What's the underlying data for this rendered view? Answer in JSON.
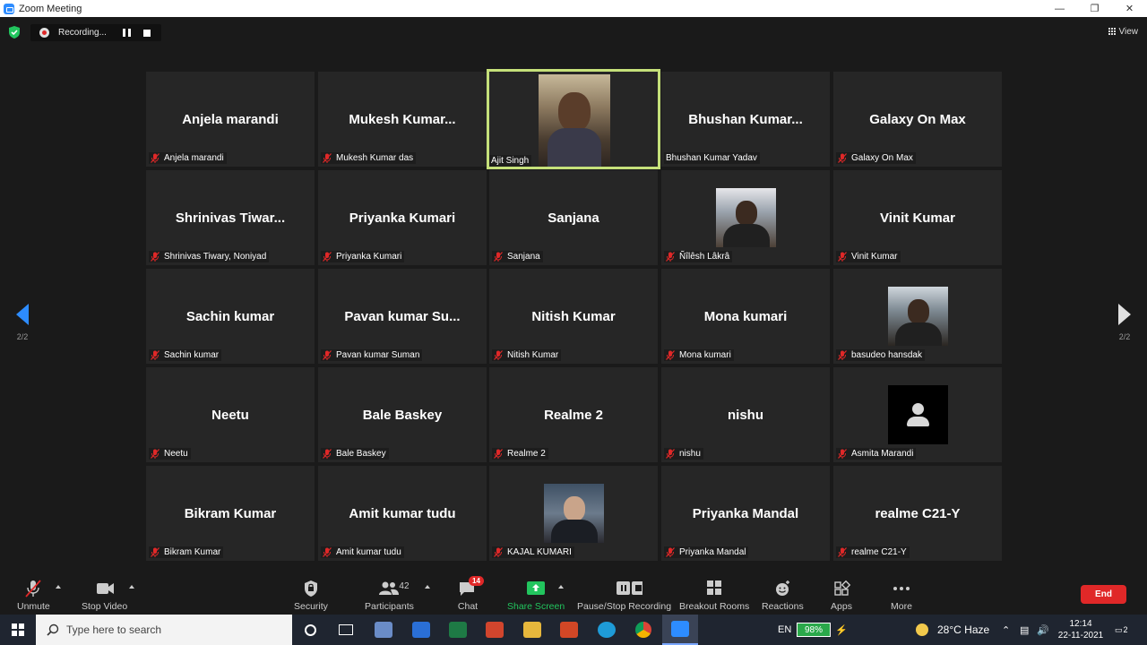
{
  "window": {
    "title": "Zoom Meeting"
  },
  "recording": {
    "status": "Recording..."
  },
  "view_label": "View",
  "pager": {
    "left": "2/2",
    "right": "2/2"
  },
  "participants": [
    {
      "big": "Anjela marandi",
      "label": "Anjela marandi",
      "muted": true
    },
    {
      "big": "Mukesh  Kumar...",
      "label": "Mukesh Kumar das",
      "muted": true
    },
    {
      "big": "",
      "label": "Ajit Singh",
      "muted": false,
      "video": true,
      "active": true
    },
    {
      "big": "Bhushan  Kumar...",
      "label": "Bhushan Kumar Yadav",
      "muted": false
    },
    {
      "big": "Galaxy On Max",
      "label": "Galaxy On Max",
      "muted": true
    },
    {
      "big": "Shrinivas  Tiwar...",
      "label": "Shrinivas Tiwary, Noniyad",
      "muted": true
    },
    {
      "big": "Priyanka Kumari",
      "label": "Priyanka Kumari",
      "muted": true
    },
    {
      "big": "Sanjana",
      "label": "Sanjana",
      "muted": true
    },
    {
      "big": "",
      "label": "Ñîlêsh Lâkrâ",
      "muted": true,
      "avatar": "photo1"
    },
    {
      "big": "Vinit Kumar",
      "label": "Vinit Kumar",
      "muted": true
    },
    {
      "big": "Sachin kumar",
      "label": "Sachin kumar",
      "muted": true
    },
    {
      "big": "Pavan kumar Su...",
      "label": "Pavan kumar Suman",
      "muted": true
    },
    {
      "big": "Nitish Kumar",
      "label": "Nitish Kumar",
      "muted": true
    },
    {
      "big": "Mona kumari",
      "label": "Mona kumari",
      "muted": true
    },
    {
      "big": "",
      "label": "basudeo hansdak",
      "muted": true,
      "avatar": "photo2"
    },
    {
      "big": "Neetu",
      "label": "Neetu",
      "muted": true
    },
    {
      "big": "Bale Baskey",
      "label": "Bale Baskey",
      "muted": true
    },
    {
      "big": "Realme 2",
      "label": "Realme 2",
      "muted": true
    },
    {
      "big": "nishu",
      "label": "nishu",
      "muted": true
    },
    {
      "big": "",
      "label": "Asmita Marandi",
      "muted": true,
      "avatar": "blank"
    },
    {
      "big": "Bikram Kumar",
      "label": "Bikram Kumar",
      "muted": true
    },
    {
      "big": "Amit kumar tudu",
      "label": "Amit kumar tudu",
      "muted": true
    },
    {
      "big": "",
      "label": "KAJAL KUMARI",
      "muted": true,
      "avatar": "photo3"
    },
    {
      "big": "Priyanka Mandal",
      "label": "Priyanka Mandal",
      "muted": true
    },
    {
      "big": "realme C21-Y",
      "label": "realme C21-Y",
      "muted": true
    }
  ],
  "toolbar": {
    "unmute": "Unmute",
    "stop_video": "Stop Video",
    "security": "Security",
    "participants": "Participants",
    "participants_count": "42",
    "chat": "Chat",
    "chat_badge": "14",
    "share_screen": "Share Screen",
    "pause_stop_recording": "Pause/Stop Recording",
    "breakout_rooms": "Breakout Rooms",
    "reactions": "Reactions",
    "apps": "Apps",
    "more": "More",
    "end": "End"
  },
  "taskbar": {
    "search_placeholder": "Type here to search",
    "language": "EN",
    "battery": "98%",
    "weather": "28°C  Haze",
    "time": "12:14",
    "date": "22-11-2021",
    "notifications": "2"
  },
  "colors": {
    "accent": "#2d8cff",
    "end": "#e02828",
    "share": "#22c55e",
    "active_border": "#c5e07a"
  }
}
